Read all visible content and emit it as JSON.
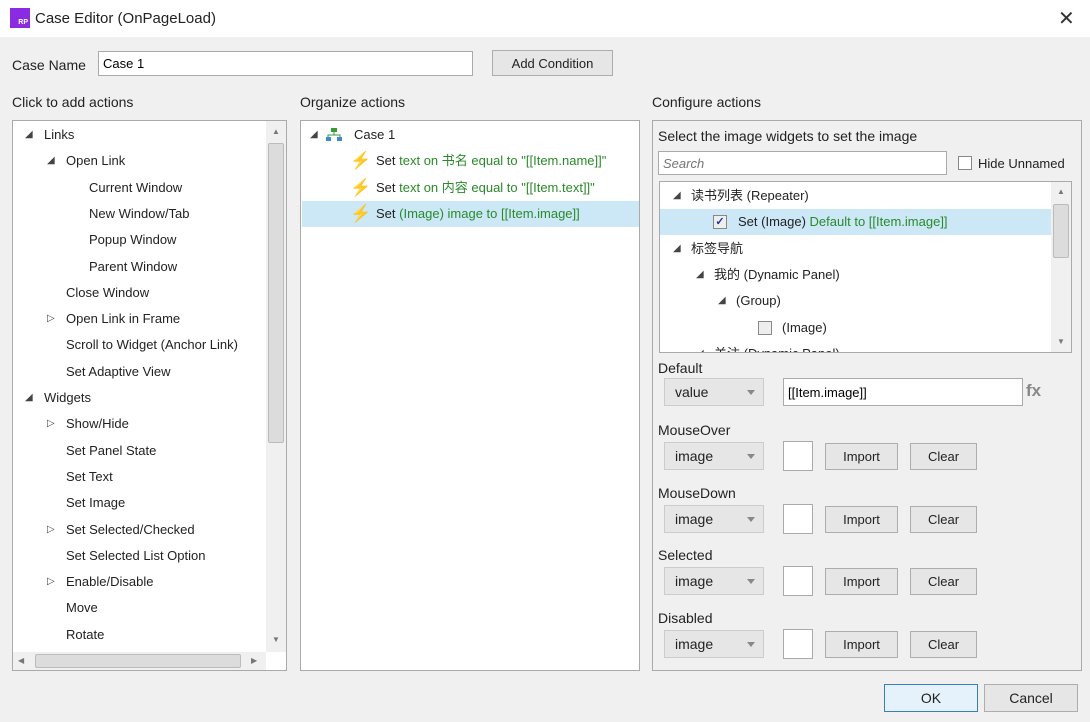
{
  "window": {
    "title": "Case Editor (OnPageLoad)",
    "logo_text": "RP"
  },
  "case_name": {
    "label": "Case Name",
    "value": "Case 1"
  },
  "add_condition": "Add Condition",
  "left": {
    "header": "Click to add actions",
    "items": [
      {
        "label": "Links",
        "level": 0,
        "toggle": "expanded"
      },
      {
        "label": "Open Link",
        "level": 1,
        "toggle": "expanded"
      },
      {
        "label": "Current Window",
        "level": 2
      },
      {
        "label": "New Window/Tab",
        "level": 2
      },
      {
        "label": "Popup Window",
        "level": 2
      },
      {
        "label": "Parent Window",
        "level": 2
      },
      {
        "label": "Close Window",
        "level": 1
      },
      {
        "label": "Open Link in Frame",
        "level": 1,
        "toggle": "collapsed"
      },
      {
        "label": "Scroll to Widget (Anchor Link)",
        "level": 1
      },
      {
        "label": "Set Adaptive View",
        "level": 1
      },
      {
        "label": "Widgets",
        "level": 0,
        "toggle": "expanded"
      },
      {
        "label": "Show/Hide",
        "level": 1,
        "toggle": "collapsed"
      },
      {
        "label": "Set Panel State",
        "level": 1
      },
      {
        "label": "Set Text",
        "level": 1
      },
      {
        "label": "Set Image",
        "level": 1
      },
      {
        "label": "Set Selected/Checked",
        "level": 1,
        "toggle": "collapsed"
      },
      {
        "label": "Set Selected List Option",
        "level": 1
      },
      {
        "label": "Enable/Disable",
        "level": 1,
        "toggle": "collapsed"
      },
      {
        "label": "Move",
        "level": 1
      },
      {
        "label": "Rotate",
        "level": 1
      }
    ]
  },
  "middle": {
    "header": "Organize actions",
    "case_label": "Case 1",
    "actions": [
      {
        "verb": "Set",
        "detail": "text on 书名 equal to \"[[Item.name]]\"",
        "selected": false
      },
      {
        "verb": "Set",
        "detail": "text on 内容 equal to \"[[Item.text]]\"",
        "selected": false
      },
      {
        "verb": "Set",
        "detail": "(Image) image to [[Item.image]]",
        "selected": true
      }
    ]
  },
  "right": {
    "header": "Configure actions",
    "instruction": "Select the image widgets to set the image",
    "search_placeholder": "Search",
    "hide_unnamed": "Hide Unnamed",
    "tree": [
      {
        "label": "读书列表 (Repeater)",
        "toggle": "expanded",
        "level": 0
      },
      {
        "label": "Set (Image)",
        "extra": " Default to [[Item.image]]",
        "checkbox": true,
        "checked": true,
        "level": 1,
        "selected": true
      },
      {
        "label": "标签导航",
        "toggle": "expanded",
        "level": 0
      },
      {
        "label": "我的 (Dynamic Panel)",
        "toggle": "expanded",
        "level": 1
      },
      {
        "label": "(Group)",
        "toggle": "expanded",
        "level": 2
      },
      {
        "label": "(Image)",
        "checkbox": true,
        "checked": false,
        "level": 3
      },
      {
        "label": "关注 (Dynamic Panel)",
        "toggle": "expanded",
        "level": 1
      }
    ],
    "default": {
      "label": "Default",
      "type": "value",
      "value": "[[Item.image]]",
      "fx": "fx"
    },
    "states": [
      {
        "label": "MouseOver",
        "type": "image",
        "import": "Import",
        "clear": "Clear"
      },
      {
        "label": "MouseDown",
        "type": "image",
        "import": "Import",
        "clear": "Clear"
      },
      {
        "label": "Selected",
        "type": "image",
        "import": "Import",
        "clear": "Clear"
      },
      {
        "label": "Disabled",
        "type": "image",
        "import": "Import",
        "clear": "Clear"
      }
    ]
  },
  "footer": {
    "ok": "OK",
    "cancel": "Cancel"
  }
}
